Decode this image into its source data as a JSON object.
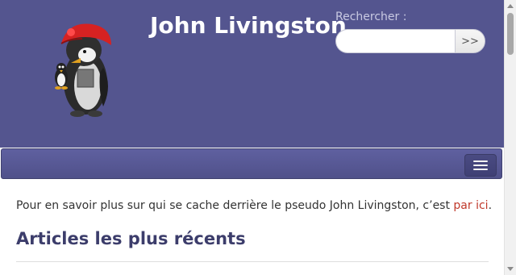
{
  "header": {
    "site_title": "John Livingston",
    "logo_icon": "penguin-mascot-icon"
  },
  "search": {
    "label": "Rechercher :",
    "value": "",
    "placeholder": "",
    "button_label": ">>"
  },
  "navbar": {
    "menu_icon": "hamburger-menu-icon"
  },
  "content": {
    "intro_text": "Pour en savoir plus sur qui se cache derrière le pseudo John Livingston, c’est ",
    "intro_link": "par ici",
    "intro_end": ".",
    "section_title": "Articles les plus récents"
  },
  "colors": {
    "header_bg": "#54558f",
    "link": "#c0392b",
    "heading": "#3c3d6b"
  }
}
